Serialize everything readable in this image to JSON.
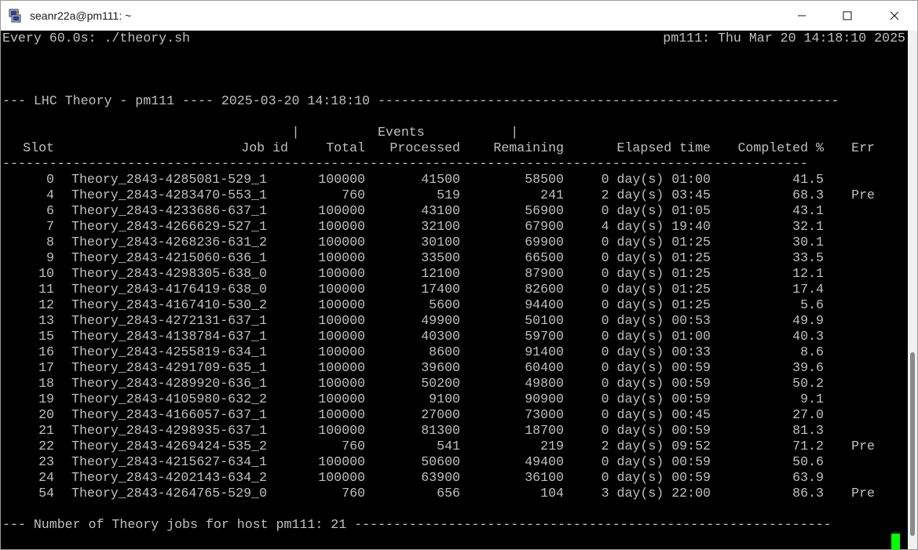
{
  "window": {
    "title": "seanr22a@pm111: ~",
    "controls": {
      "minimize": "minimize-icon",
      "maximize": "maximize-icon",
      "close": "close-icon"
    }
  },
  "terminal": {
    "watch_left": "Every 60.0s: ./theory.sh",
    "watch_right": "pm111: Thu Mar 20 14:18:10 2025",
    "banner": "--- LHC Theory - pm111 ---- 2025-03-20 14:18:10 -----------------------------------------------------------",
    "header1": "                                     |          Events           |",
    "headers": {
      "slot": "Slot",
      "job_id": "Job id",
      "total": "Total",
      "processed": "Processed",
      "remaining": "Remaining",
      "elapsed": "Elapsed time",
      "completed": "Completed %",
      "err": "Err"
    },
    "separator": "-------------------------------------------------------------------------------------------------------",
    "rows": [
      {
        "slot": "0",
        "job_id": "Theory_2843-4285081-529_1",
        "total": "100000",
        "processed": "41500",
        "remaining": "58500",
        "elapsed": "0 day(s) 01:00",
        "completed": "41.5",
        "err": ""
      },
      {
        "slot": "4",
        "job_id": "Theory_2843-4283470-553_1",
        "total": "760",
        "processed": "519",
        "remaining": "241",
        "elapsed": "2 day(s) 03:45",
        "completed": "68.3",
        "err": "Pre"
      },
      {
        "slot": "6",
        "job_id": "Theory_2843-4233686-637_1",
        "total": "100000",
        "processed": "43100",
        "remaining": "56900",
        "elapsed": "0 day(s) 01:05",
        "completed": "43.1",
        "err": ""
      },
      {
        "slot": "7",
        "job_id": "Theory_2843-4266629-527_1",
        "total": "100000",
        "processed": "32100",
        "remaining": "67900",
        "elapsed": "4 day(s) 19:40",
        "completed": "32.1",
        "err": ""
      },
      {
        "slot": "8",
        "job_id": "Theory_2843-4268236-631_2",
        "total": "100000",
        "processed": "30100",
        "remaining": "69900",
        "elapsed": "0 day(s) 01:25",
        "completed": "30.1",
        "err": ""
      },
      {
        "slot": "9",
        "job_id": "Theory_2843-4215060-636_1",
        "total": "100000",
        "processed": "33500",
        "remaining": "66500",
        "elapsed": "0 day(s) 01:25",
        "completed": "33.5",
        "err": ""
      },
      {
        "slot": "10",
        "job_id": "Theory_2843-4298305-638_0",
        "total": "100000",
        "processed": "12100",
        "remaining": "87900",
        "elapsed": "0 day(s) 01:25",
        "completed": "12.1",
        "err": ""
      },
      {
        "slot": "11",
        "job_id": "Theory_2843-4176419-638_0",
        "total": "100000",
        "processed": "17400",
        "remaining": "82600",
        "elapsed": "0 day(s) 01:25",
        "completed": "17.4",
        "err": ""
      },
      {
        "slot": "12",
        "job_id": "Theory_2843-4167410-530_2",
        "total": "100000",
        "processed": "5600",
        "remaining": "94400",
        "elapsed": "0 day(s) 01:25",
        "completed": "5.6",
        "err": ""
      },
      {
        "slot": "13",
        "job_id": "Theory_2843-4272131-637_1",
        "total": "100000",
        "processed": "49900",
        "remaining": "50100",
        "elapsed": "0 day(s) 00:53",
        "completed": "49.9",
        "err": ""
      },
      {
        "slot": "15",
        "job_id": "Theory_2843-4138784-637_1",
        "total": "100000",
        "processed": "40300",
        "remaining": "59700",
        "elapsed": "0 day(s) 01:00",
        "completed": "40.3",
        "err": ""
      },
      {
        "slot": "16",
        "job_id": "Theory_2843-4255819-634_1",
        "total": "100000",
        "processed": "8600",
        "remaining": "91400",
        "elapsed": "0 day(s) 00:33",
        "completed": "8.6",
        "err": ""
      },
      {
        "slot": "17",
        "job_id": "Theory_2843-4291709-635_1",
        "total": "100000",
        "processed": "39600",
        "remaining": "60400",
        "elapsed": "0 day(s) 00:59",
        "completed": "39.6",
        "err": ""
      },
      {
        "slot": "18",
        "job_id": "Theory_2843-4289920-636_1",
        "total": "100000",
        "processed": "50200",
        "remaining": "49800",
        "elapsed": "0 day(s) 00:59",
        "completed": "50.2",
        "err": ""
      },
      {
        "slot": "19",
        "job_id": "Theory_2843-4105980-632_2",
        "total": "100000",
        "processed": "9100",
        "remaining": "90900",
        "elapsed": "0 day(s) 00:59",
        "completed": "9.1",
        "err": ""
      },
      {
        "slot": "20",
        "job_id": "Theory_2843-4166057-637_1",
        "total": "100000",
        "processed": "27000",
        "remaining": "73000",
        "elapsed": "0 day(s) 00:45",
        "completed": "27.0",
        "err": ""
      },
      {
        "slot": "21",
        "job_id": "Theory_2843-4298935-637_1",
        "total": "100000",
        "processed": "81300",
        "remaining": "18700",
        "elapsed": "0 day(s) 00:59",
        "completed": "81.3",
        "err": ""
      },
      {
        "slot": "22",
        "job_id": "Theory_2843-4269424-535_2",
        "total": "760",
        "processed": "541",
        "remaining": "219",
        "elapsed": "2 day(s) 09:52",
        "completed": "71.2",
        "err": "Pre"
      },
      {
        "slot": "23",
        "job_id": "Theory_2843-4215627-634_1",
        "total": "100000",
        "processed": "50600",
        "remaining": "49400",
        "elapsed": "0 day(s) 00:59",
        "completed": "50.6",
        "err": ""
      },
      {
        "slot": "24",
        "job_id": "Theory_2843-4202143-634_2",
        "total": "100000",
        "processed": "63900",
        "remaining": "36100",
        "elapsed": "0 day(s) 00:59",
        "completed": "63.9",
        "err": ""
      },
      {
        "slot": "54",
        "job_id": "Theory_2843-4264765-529_0",
        "total": "760",
        "processed": "656",
        "remaining": "104",
        "elapsed": "3 day(s) 22:00",
        "completed": "86.3",
        "err": "Pre"
      }
    ],
    "footer": "--- Number of Theory jobs for host pm111: 21 -------------------------------------------------------------"
  },
  "colors": {
    "terminal_bg": "#000000",
    "terminal_fg": "#c0c0c0",
    "cursor": "#00ff00",
    "titlebar_bg": "#ffffff"
  }
}
